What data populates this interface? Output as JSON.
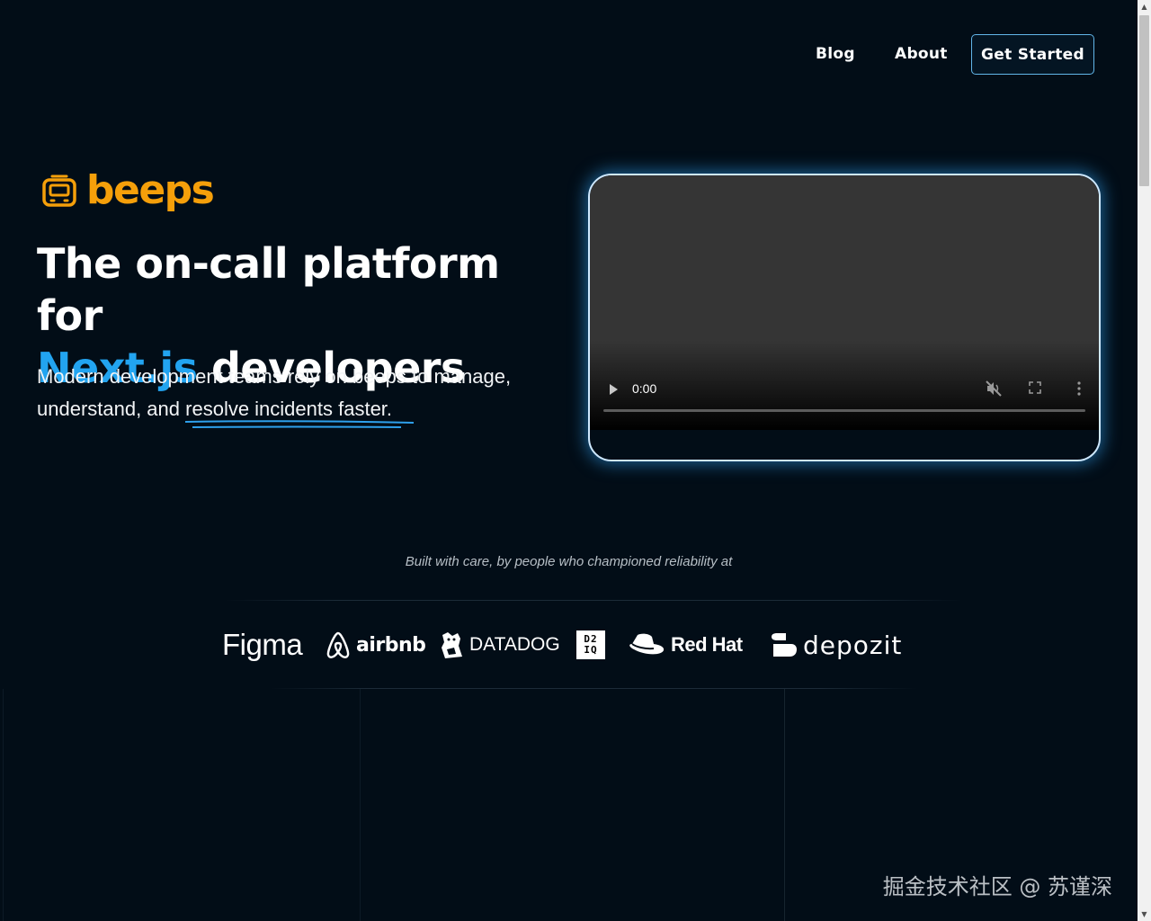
{
  "nav": {
    "blog": "Blog",
    "about": "About",
    "cta": "Get Started"
  },
  "brand": {
    "name": "beeps",
    "color": "#f59f0a",
    "icon": "tv-icon"
  },
  "hero": {
    "headline_part1": "The on-call platform for",
    "headline_accent": "Next.js",
    "headline_part2": " developers",
    "accent_color": "#22a4f0",
    "subtitle_part1": "Modern development teams rely on beeps to manage, understand, and ",
    "subtitle_underlined": "resolve incidents faster."
  },
  "video": {
    "time": "0:00",
    "progress": 0
  },
  "trusted": {
    "caption": "Built with care, by people who championed reliability at",
    "companies": {
      "figma": "Figma",
      "airbnb": "airbnb",
      "datadog": "DATADOG",
      "d2iq_line1": "D2",
      "d2iq_line2": "IQ",
      "redhat": "Red Hat",
      "depozit": "depozit"
    }
  },
  "watermark": "掘金技术社区 @ 苏谨深"
}
